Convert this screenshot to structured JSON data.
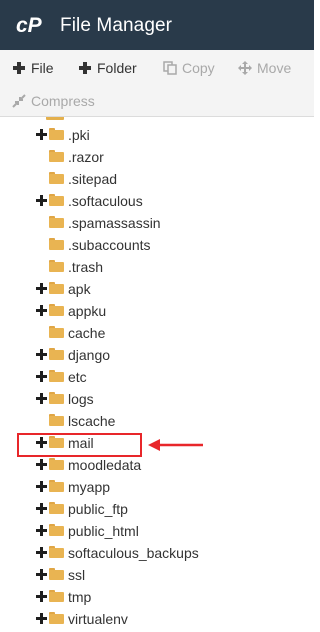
{
  "header": {
    "app_title": "File Manager",
    "logo_icon": "cpanel-logo-icon",
    "background_color": "#293a4a"
  },
  "toolbar": {
    "buttons": [
      {
        "label": "File",
        "icon": "plus-icon",
        "enabled": true
      },
      {
        "label": "Folder",
        "icon": "plus-icon",
        "enabled": true
      },
      {
        "label": "Copy",
        "icon": "copy-icon",
        "enabled": false
      },
      {
        "label": "Move",
        "icon": "move-icon",
        "enabled": false
      },
      {
        "label": "Compress",
        "icon": "compress-icon",
        "enabled": false
      }
    ]
  },
  "tree": {
    "items": [
      {
        "name": ".pki",
        "expandable": true
      },
      {
        "name": ".razor",
        "expandable": false
      },
      {
        "name": ".sitepad",
        "expandable": false
      },
      {
        "name": ".softaculous",
        "expandable": true
      },
      {
        "name": ".spamassassin",
        "expandable": false
      },
      {
        "name": ".subaccounts",
        "expandable": false
      },
      {
        "name": ".trash",
        "expandable": false
      },
      {
        "name": "apk",
        "expandable": true
      },
      {
        "name": "appku",
        "expandable": true
      },
      {
        "name": "cache",
        "expandable": false
      },
      {
        "name": "django",
        "expandable": true
      },
      {
        "name": "etc",
        "expandable": true
      },
      {
        "name": "logs",
        "expandable": true
      },
      {
        "name": "lscache",
        "expandable": false
      },
      {
        "name": "mail",
        "expandable": true,
        "highlighted": true
      },
      {
        "name": "moodledata",
        "expandable": true
      },
      {
        "name": "myapp",
        "expandable": true
      },
      {
        "name": "public_ftp",
        "expandable": true
      },
      {
        "name": "public_html",
        "expandable": true
      },
      {
        "name": "softaculous_backups",
        "expandable": true
      },
      {
        "name": "ssl",
        "expandable": true
      },
      {
        "name": "tmp",
        "expandable": true
      },
      {
        "name": "virtualenv",
        "expandable": true
      }
    ]
  },
  "annotation": {
    "highlight_color": "#e8262a"
  }
}
